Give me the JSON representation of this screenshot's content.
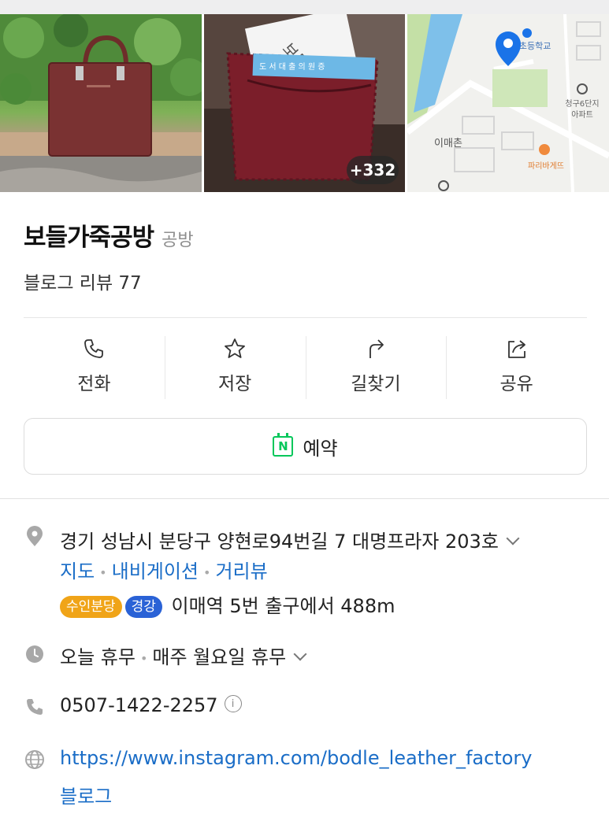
{
  "gallery": {
    "more_photos_label": "+332",
    "map_labels": {
      "school": "안말초등학교",
      "apartment_line1": "청구6단지",
      "apartment_line2": "아파트",
      "area": "이매촌",
      "bakery": "파리바게뜨"
    },
    "card_text": "도 서 대 출 의 원 증"
  },
  "place": {
    "name": "보들가죽공방",
    "category": "공방",
    "review_text": "블로그 리뷰 77"
  },
  "actions": [
    {
      "label": "전화",
      "icon": "phone-icon"
    },
    {
      "label": "저장",
      "icon": "star-icon"
    },
    {
      "label": "길찾기",
      "icon": "directions-icon"
    },
    {
      "label": "공유",
      "icon": "share-icon"
    }
  ],
  "reserve": {
    "label": "예약",
    "icon": "naver-booking-icon"
  },
  "info": {
    "address": "경기 성남시 분당구 양현로94번길 7 대명프라자 203호",
    "address_links": [
      "지도",
      "내비게이션",
      "거리뷰"
    ],
    "subway": {
      "line1": "수인분당",
      "line2": "경강",
      "text": "이매역 5번 출구에서 488m"
    },
    "hours_status": "오늘 휴무",
    "hours_detail": "매주 월요일 휴무",
    "phone": "0507-1422-2257",
    "website": "https://www.instagram.com/bodle_leather_factory",
    "blog": "블로그"
  },
  "colors": {
    "link": "#1a6dc7",
    "naver_green": "#03c75a",
    "badge_suin_bundang": "#f0a418",
    "badge_gyeonggang": "#2a62d6",
    "map_pin": "#1a73e8"
  }
}
